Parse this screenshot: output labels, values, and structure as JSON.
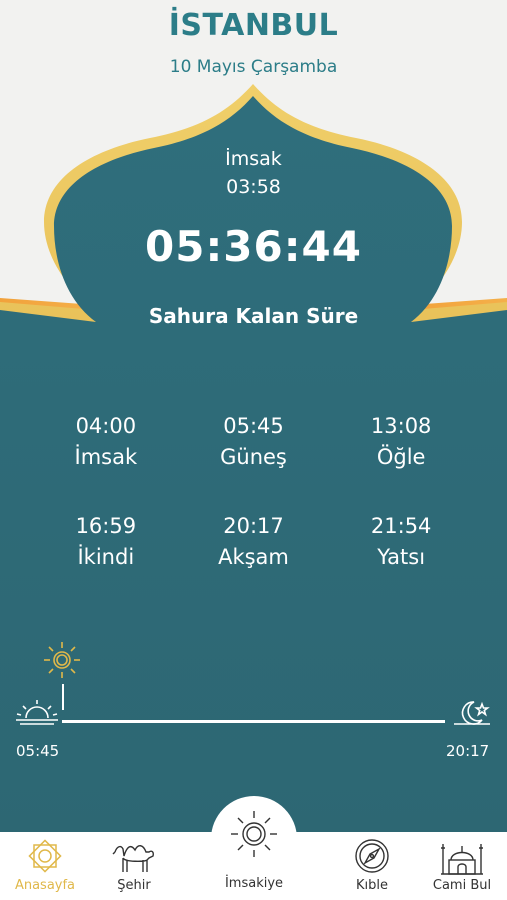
{
  "header": {
    "city": "İSTANBUL",
    "date": "10 Mayıs Çarşamba"
  },
  "next_prayer": {
    "name": "İmsak",
    "time": "03:58"
  },
  "countdown": {
    "value": "05:36:44",
    "label": "Sahura Kalan Süre"
  },
  "prayer_times": [
    {
      "time": "04:00",
      "name": "İmsak"
    },
    {
      "time": "05:45",
      "name": "Güneş"
    },
    {
      "time": "13:08",
      "name": "Öğle"
    },
    {
      "time": "16:59",
      "name": "İkindi"
    },
    {
      "time": "20:17",
      "name": "Akşam"
    },
    {
      "time": "21:54",
      "name": "Yatsı"
    }
  ],
  "sun_timeline": {
    "sunrise": "05:45",
    "sunset": "20:17"
  },
  "tabs": [
    {
      "label": "Anasayfa",
      "icon": "star-octagon-icon",
      "active": true
    },
    {
      "label": "Şehir",
      "icon": "camel-icon",
      "active": false
    },
    {
      "label": "İmsakiye",
      "icon": "sun-calendar-icon",
      "active": false
    },
    {
      "label": "Kıble",
      "icon": "compass-icon",
      "active": false
    },
    {
      "label": "Cami Bul",
      "icon": "mosque-icon",
      "active": false
    }
  ],
  "colors": {
    "teal": "#2f6a78",
    "gold": "#e0b84a",
    "title": "#2c7d88",
    "background": "#f2f2f0"
  }
}
